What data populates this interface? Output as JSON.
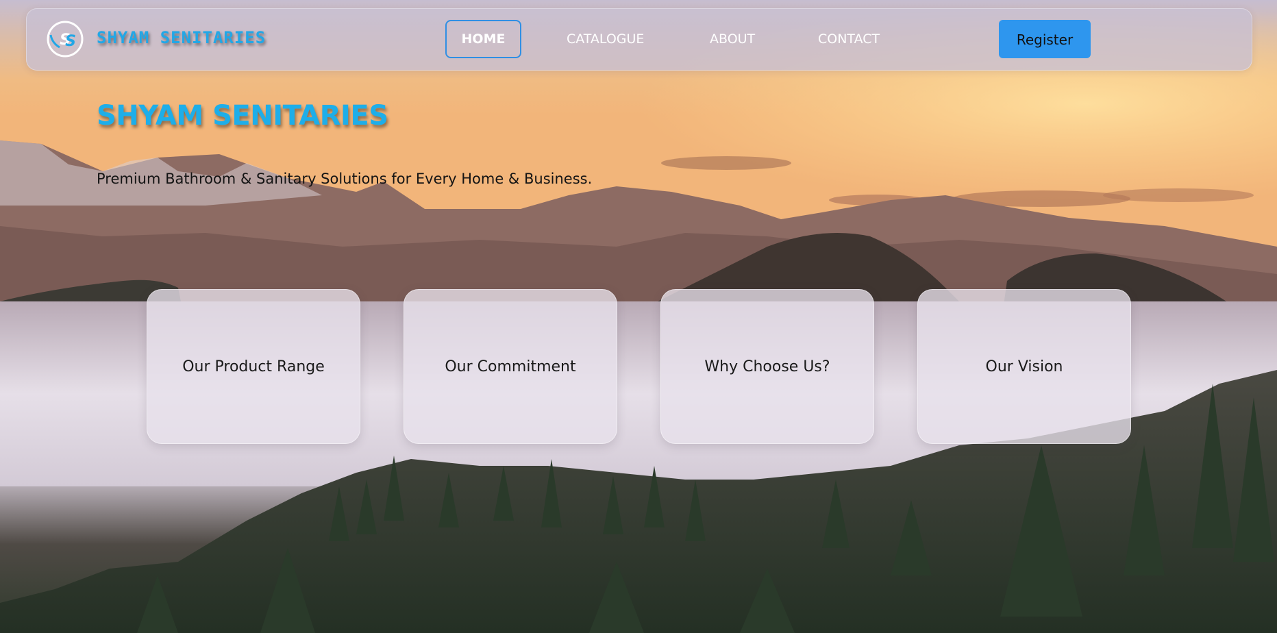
{
  "navbar": {
    "brand": "SHYAM SENITARIES",
    "logo_icon": "ss-monogram-icon",
    "links": [
      "HOME",
      "CATALOGUE",
      "ABOUT",
      "CONTACT"
    ],
    "active_link": "HOME",
    "register_label": "Register"
  },
  "hero": {
    "title": "SHYAM SENITARIES",
    "subtitle": "Premium Bathroom & Sanitary Solutions for Every Home & Business."
  },
  "cards": [
    {
      "label": "Our Product Range"
    },
    {
      "label": "Our Commitment"
    },
    {
      "label": "Why Choose Us?"
    },
    {
      "label": "Our Vision"
    }
  ],
  "colors": {
    "brand_blue": "#1eaee9",
    "register_blue": "#2e96ee",
    "active_border": "#2f8fe4"
  }
}
